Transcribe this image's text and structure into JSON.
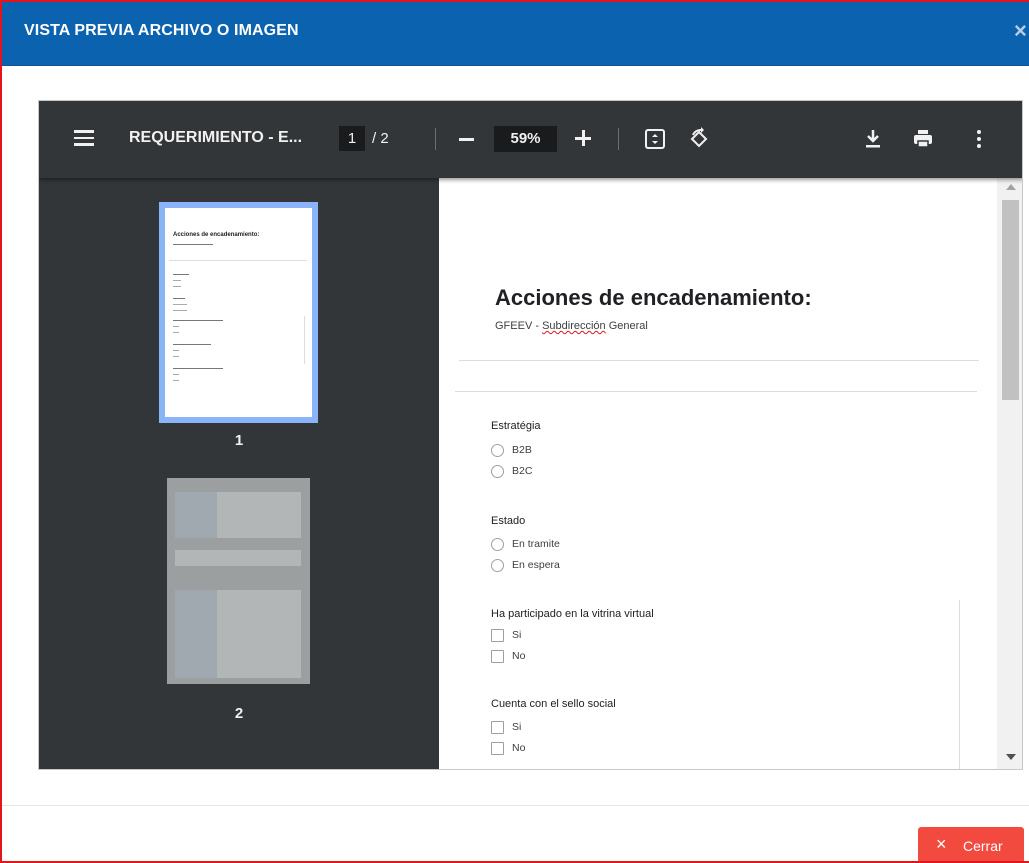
{
  "modal": {
    "title": "VISTA PREVIA ARCHIVO O IMAGEN",
    "close_glyph": "×",
    "close_button_label": "Cerrar"
  },
  "viewer": {
    "file_title": "REQUERIMIENTO - E...",
    "current_page": "1",
    "page_separator": "/ 2",
    "zoom": "59%",
    "icons": [
      "menu-icon",
      "zoom-out-icon",
      "zoom-in-icon",
      "fit-page-icon",
      "rotate-icon",
      "download-icon",
      "print-icon",
      "more-options-icon"
    ]
  },
  "thumbnails": [
    {
      "label": "1",
      "mini_title": "Acciones de encadenamiento:"
    },
    {
      "label": "2"
    }
  ],
  "document": {
    "title": "Acciones de encadenamiento:",
    "subtitle_prefix": "GFEEV - ",
    "subtitle_link": "Subdirección",
    "subtitle_suffix": " General",
    "questions": [
      {
        "label": "Estratégia",
        "type": "radio",
        "options": [
          "B2B",
          "B2C"
        ]
      },
      {
        "label": "Estado",
        "type": "radio",
        "options": [
          "En tramite",
          "En espera"
        ]
      },
      {
        "label": "Ha participado en la vitrina virtual",
        "type": "checkbox",
        "options": [
          "Si",
          "No"
        ]
      },
      {
        "label": "Cuenta con el sello social",
        "type": "checkbox",
        "options": [
          "Si",
          "No"
        ]
      }
    ]
  },
  "colors": {
    "header_blue": "#0b62ae",
    "accent_red": "#f24a3e",
    "border_red": "#e2141c",
    "viewer_toolbar": "#323639",
    "thumb_highlight": "#8ab4f8"
  }
}
